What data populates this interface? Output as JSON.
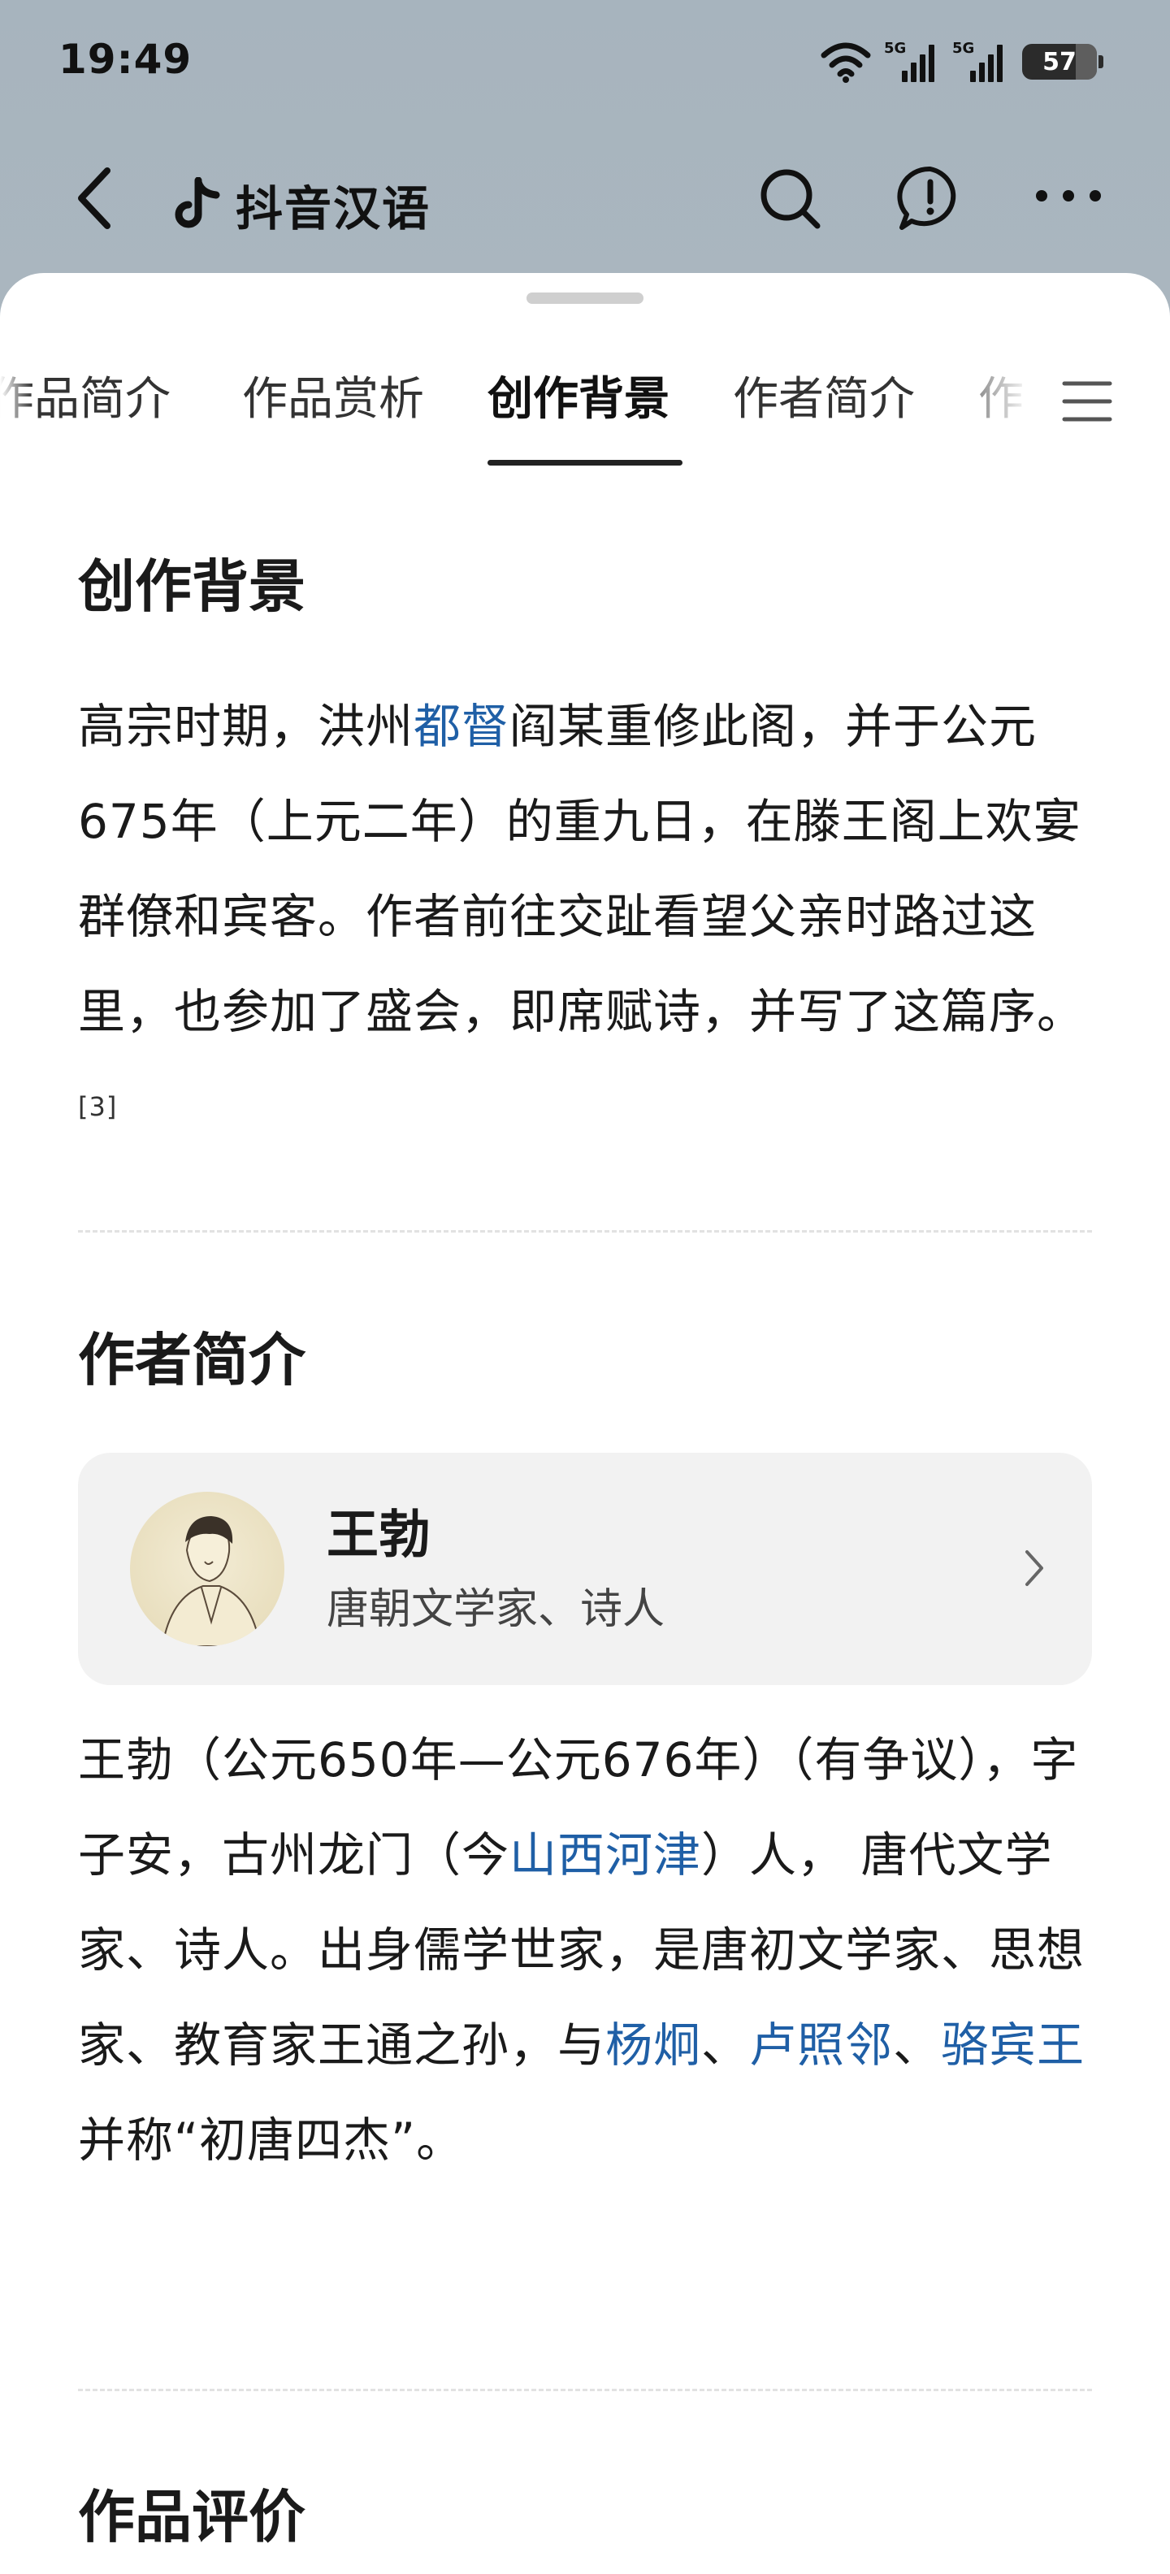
{
  "status_bar": {
    "time": "19:49",
    "signal1_label": "5G",
    "signal2_label": "5G",
    "battery": "57"
  },
  "nav": {
    "brand": "抖音汉语"
  },
  "tabs": [
    {
      "label": "作品简介"
    },
    {
      "label": "作品赏析"
    },
    {
      "label": "创作背景"
    },
    {
      "label": "作者简介"
    },
    {
      "label": "作"
    }
  ],
  "active_tab": "创作背景",
  "background": {
    "title": "创作背景",
    "p1": "高宗时期，洪州",
    "link1": "都督",
    "p2": "阎某重修此阁，并于公元675年（上元二年）的重九日，在滕王阁上欢宴群僚和宾客。作者前往交趾看望父亲时路过这里，也参加了盛会，即席赋诗，并写了这篇序。",
    "ref": "[3]"
  },
  "author": {
    "title": "作者简介",
    "card_name": "王勃",
    "card_subtitle": "唐朝文学家、诗人",
    "p1": "王勃（公元650年—公元676年）（有争议），字子安，古州龙门（今",
    "link_shanxi": "山西河津",
    "p2": "）人， 唐代文学家、诗人。出身儒学世家，是唐初文学家、思想家、教育家王通之孙，与",
    "link_yang": "杨炯",
    "sep1": "、",
    "link_lu": "卢照邻",
    "sep2": "、",
    "link_luo": "骆宾王",
    "p3": "并称“初唐四杰”。"
  },
  "evaluation": {
    "title": "作品评价"
  },
  "colors": {
    "link": "#1f5fa6",
    "header_bg": "#a9b6c0"
  }
}
